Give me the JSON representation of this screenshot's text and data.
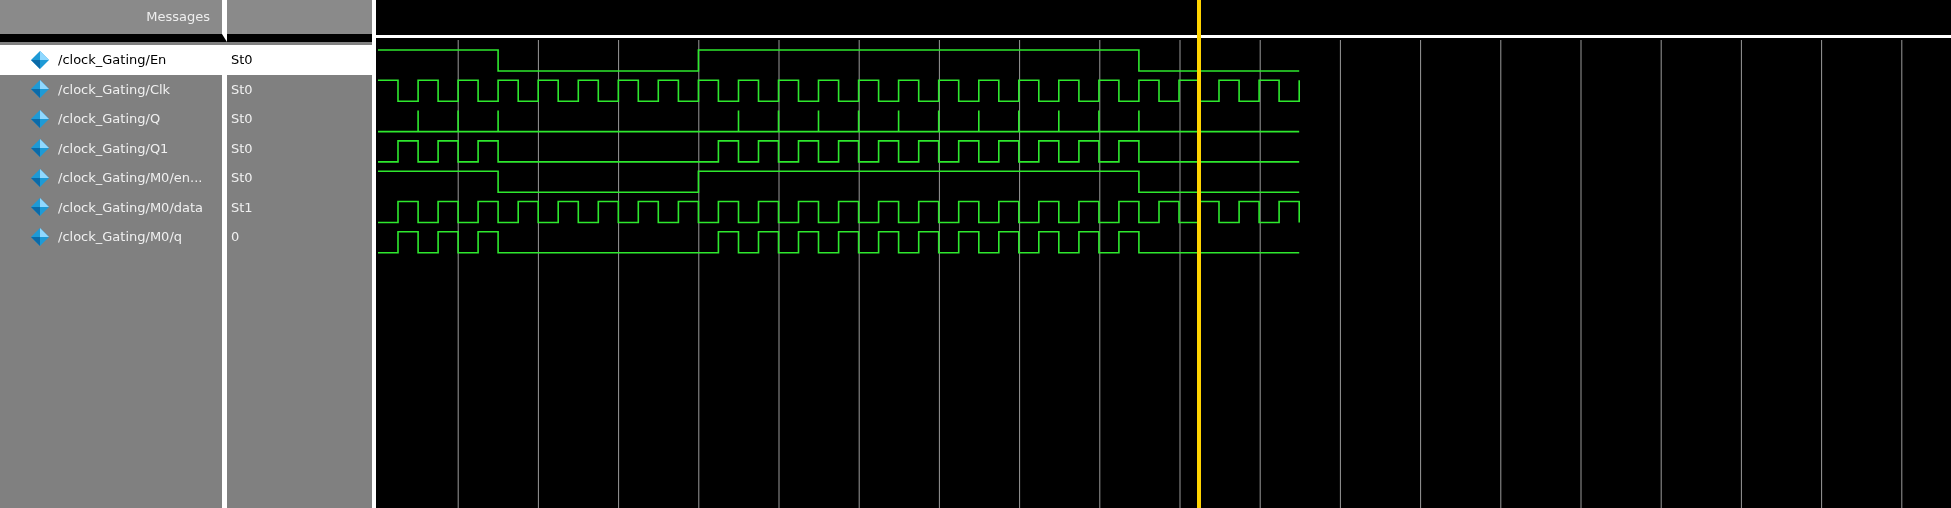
{
  "header": {
    "label": "Messages"
  },
  "signals": [
    {
      "name": "/clock_Gating/En",
      "value": "St0",
      "selected": true
    },
    {
      "name": "/clock_Gating/Clk",
      "value": "St0",
      "selected": false
    },
    {
      "name": "/clock_Gating/Q",
      "value": "St0",
      "selected": false
    },
    {
      "name": "/clock_Gating/Q1",
      "value": "St0",
      "selected": false
    },
    {
      "name": "/clock_Gating/M0/en...",
      "value": "St0",
      "selected": false
    },
    {
      "name": "/clock_Gating/M0/data",
      "value": "St1",
      "selected": false
    },
    {
      "name": "/clock_Gating/M0/q",
      "value": "0",
      "selected": false
    }
  ]
}
